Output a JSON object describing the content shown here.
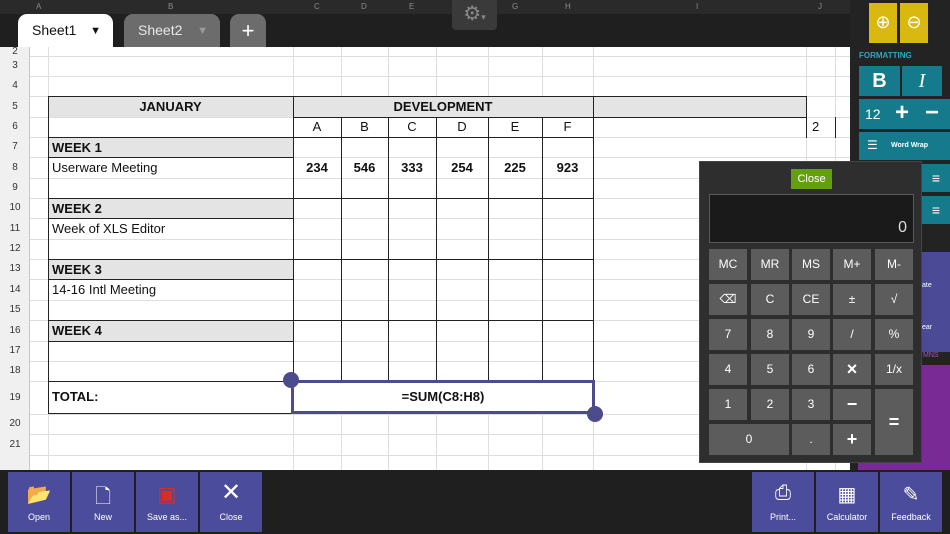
{
  "tabs": [
    {
      "label": "Sheet1",
      "active": true
    },
    {
      "label": "Sheet2",
      "active": false
    }
  ],
  "add_tab_symbol": "+",
  "column_headers": [
    "A",
    "B",
    "C",
    "D",
    "E",
    "F",
    "G",
    "H",
    "I",
    "J"
  ],
  "row_numbers": [
    "2",
    "3",
    "4",
    "5",
    "6",
    "7",
    "8",
    "9",
    "10",
    "11",
    "12",
    "13",
    "14",
    "15",
    "16",
    "17",
    "18",
    "19",
    "20",
    "21"
  ],
  "sheet": {
    "january": "JANUARY",
    "development": "DEVELOPMENT",
    "letters": [
      "A",
      "B",
      "C",
      "D",
      "E",
      "F"
    ],
    "extra_col": "2",
    "week1": "WEEK 1",
    "row8_label": "Userware Meeting",
    "row8_values": [
      "234",
      "546",
      "333",
      "254",
      "225",
      "923"
    ],
    "week2": "WEEK 2",
    "row11_label": "Week of XLS Editor",
    "week3": "WEEK 3",
    "row14_label": "14-16 Intl Meeting",
    "week4": "WEEK 4",
    "total": "TOTAL:",
    "formula": "=SUM(C8:H8)"
  },
  "right_panel": {
    "formatting_label": "FORMATTING",
    "bold": "B",
    "italic": "I",
    "font_size": "12",
    "word_wrap": "Word Wrap",
    "section_label": "MNS",
    "partial_ate": "ate",
    "partial_ear": "ear"
  },
  "calculator": {
    "close": "Close",
    "display": "0",
    "keys": [
      [
        "MC",
        "MR",
        "MS",
        "M+",
        "M-"
      ],
      [
        "⌫",
        "C",
        "CE",
        "±",
        "√"
      ],
      [
        "7",
        "8",
        "9",
        "/",
        "%"
      ],
      [
        "4",
        "5",
        "6",
        "×",
        "1/x"
      ],
      [
        "1",
        "2",
        "3",
        "−",
        "="
      ],
      [
        "0",
        ".",
        "+"
      ]
    ]
  },
  "bottom_bar": {
    "open": "Open",
    "new": "New",
    "save_as": "Save as...",
    "close": "Close",
    "print": "Print...",
    "calculator": "Calculator",
    "feedback": "Feedback"
  },
  "colors": {
    "accent_purple": "#4c4c9c",
    "zoom_yellow": "#d9b80f",
    "format_teal": "#167a8d",
    "calc_close_green": "#64a00e",
    "magenta": "#7a2a95"
  }
}
